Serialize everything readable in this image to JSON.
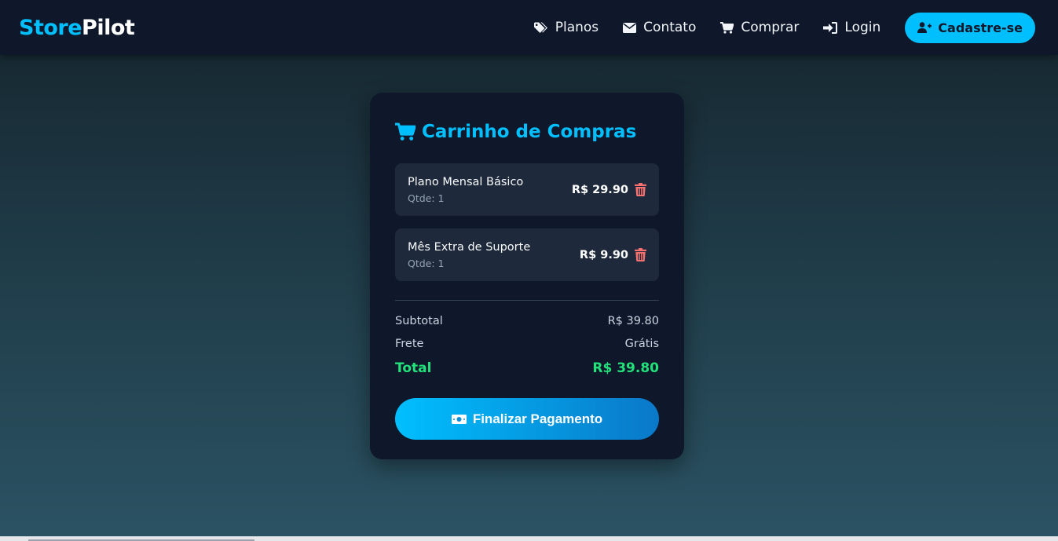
{
  "navbar": {
    "brand_part1": "Store",
    "brand_part2": "Pilot",
    "links": [
      {
        "label": "Planos",
        "icon": "tags-icon"
      },
      {
        "label": "Contato",
        "icon": "envelope-icon"
      },
      {
        "label": "Comprar",
        "icon": "cart-icon"
      },
      {
        "label": "Login",
        "icon": "sign-in-icon"
      }
    ],
    "signup_label": "Cadastre-se"
  },
  "cart": {
    "title": "Carrinho de Compras",
    "items": [
      {
        "name": "Plano Mensal Básico",
        "qty": "Qtde: 1",
        "price": "R$ 29.90"
      },
      {
        "name": "Mês Extra de Suporte",
        "qty": "Qtde: 1",
        "price": "R$ 9.90"
      }
    ],
    "subtotal_label": "Subtotal",
    "subtotal_value": "R$ 39.80",
    "shipping_label": "Frete",
    "shipping_value": "Grátis",
    "total_label": "Total",
    "total_value": "R$ 39.80",
    "checkout_label": "Finalizar Pagamento"
  },
  "colors": {
    "accent": "#00bfff",
    "total": "#22e07a",
    "delete": "#f87171",
    "card_bg": "#0f172a",
    "item_bg": "#1e293b"
  }
}
